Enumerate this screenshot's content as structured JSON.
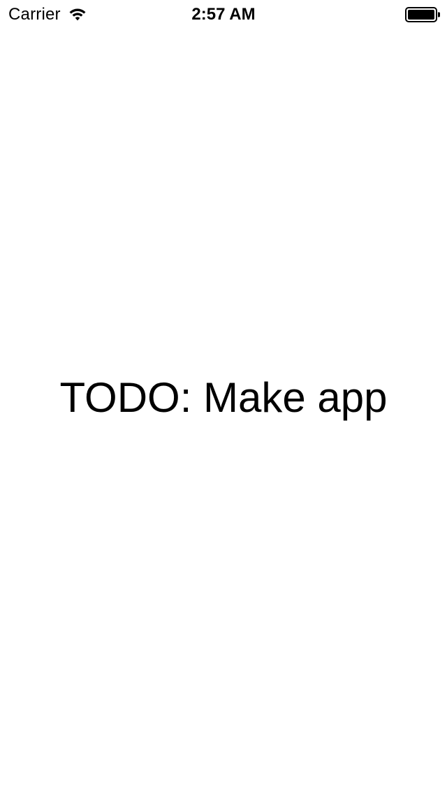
{
  "status_bar": {
    "carrier": "Carrier",
    "time": "2:57 AM",
    "signal_icon": "wifi-icon",
    "battery_icon": "battery-icon",
    "battery_level": 1.0
  },
  "main": {
    "message": "TODO: Make app"
  },
  "colors": {
    "background": "#ffffff",
    "text": "#000000"
  }
}
